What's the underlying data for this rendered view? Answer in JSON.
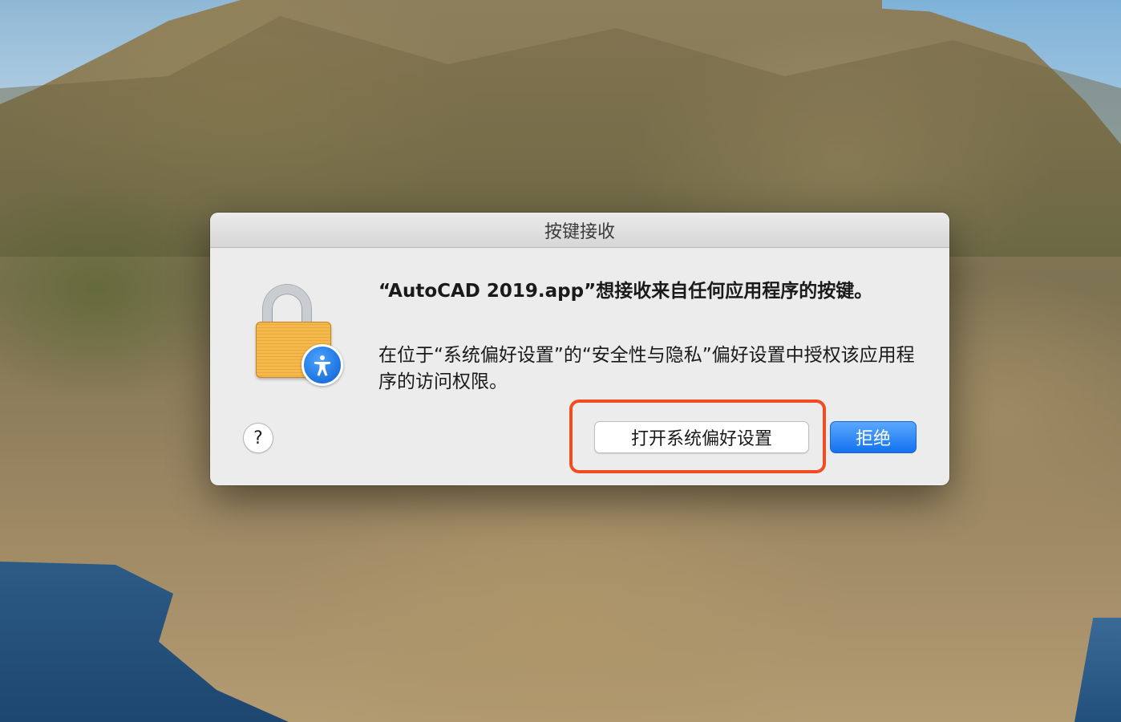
{
  "dialog": {
    "title": "按键接收",
    "heading": "“AutoCAD 2019.app”想接收来自任何应用程序的按键。",
    "body": "在位于“系统偏好设置”的“安全性与隐私”偏好设置中授权该应用程序的访问权限。",
    "help_label": "?",
    "open_prefs_label": "打开系统偏好设置",
    "deny_label": "拒绝"
  },
  "icons": {
    "lock": "lock-icon",
    "accessibility": "accessibility-icon"
  },
  "colors": {
    "primary_button": "#1472f0",
    "highlight_outline": "#f04e22",
    "lock_body": "#f4b84c"
  }
}
